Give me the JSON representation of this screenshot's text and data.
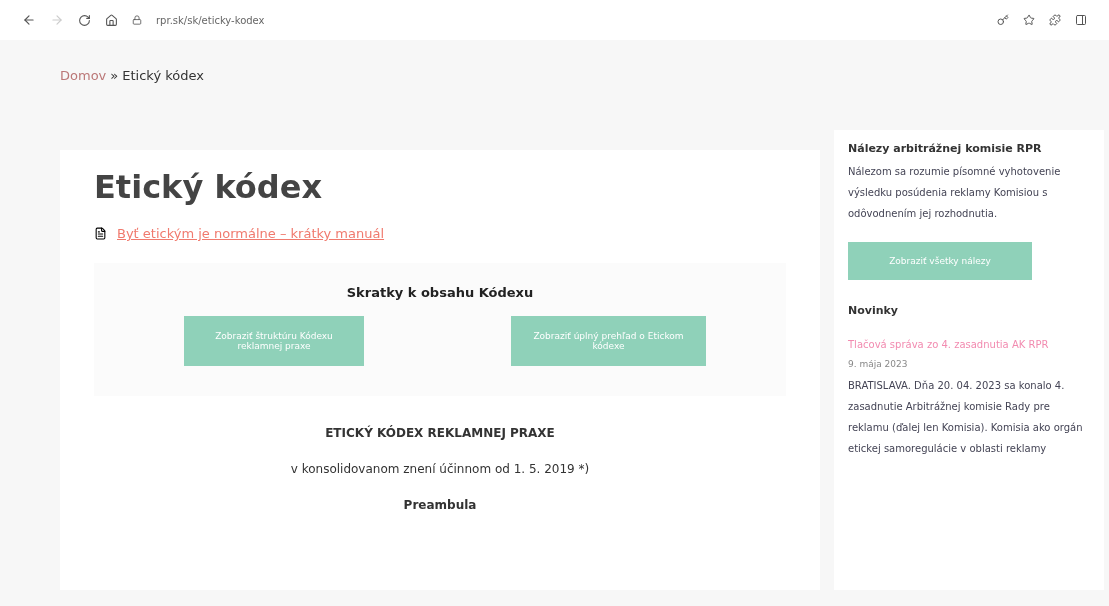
{
  "browser": {
    "url": "rpr.sk/sk/eticky-kodex"
  },
  "breadcrumb": [
    {
      "label": "Domov",
      "link": true
    },
    {
      "label": "»",
      "link": false
    },
    {
      "label": "Etický kódex",
      "link": false
    }
  ],
  "article": {
    "title": "Etický kódex",
    "download_link": "Byť etickým je normálne – krátky manuál",
    "shortcuts": {
      "heading": "Skratky k obsahu Kódexu",
      "buttons": [
        "Zobraziť štruktúru Kódexu reklamnej praxe",
        "Zobraziť úplný prehľad o Etickom kódexe"
      ]
    },
    "heading": "ETICKÝ KÓDEX REKLAMNEJ PRAXE",
    "subtitle": "v konsolidovanom znení účinnom od 1. 5. 2019 *)",
    "section": "Preambula"
  },
  "sidebar": {
    "findings": {
      "title": "Nálezy arbitrážnej komisie RPR",
      "text": "Nálezom sa rozumie písomné vyhotovenie výsledku posúdenia reklamy Komisiou s odôvodnením jej rozhodnutia.",
      "button": "Zobraziť všetky nálezy"
    },
    "news": {
      "title": "Novinky",
      "items": [
        {
          "title": "Tlačová správa zo 4. zasadnutia AK RPR",
          "date": "9. mája 2023",
          "text": "BRATISLAVA. Dňa 20. 04. 2023 sa konalo 4. zasadnutie Arbitrážnej komisie Rady pre reklamu (ďalej len Komisia). Komisia ako orgán etickej samoregulácie v oblasti reklamy"
        }
      ]
    }
  }
}
